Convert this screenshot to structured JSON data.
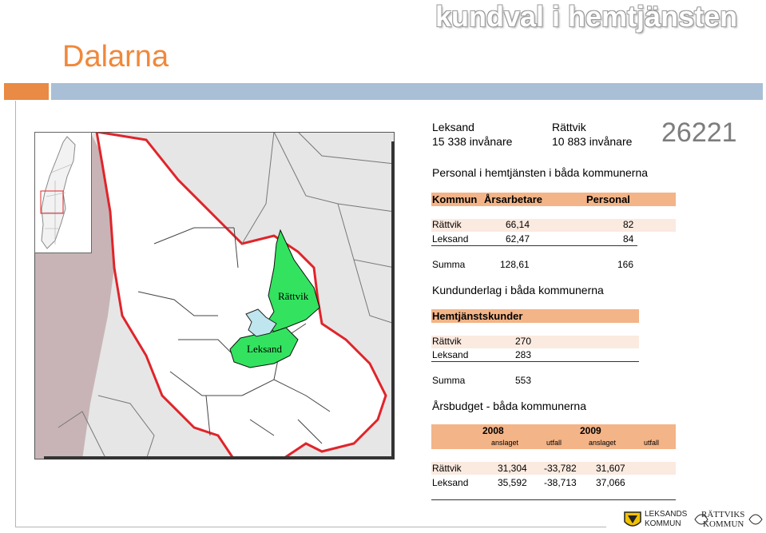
{
  "heading": "kundval i hemtjänsten",
  "title": "Dalarna",
  "municipalities": {
    "leksand_name": "Leksand",
    "leksand_pop": "15 338 invånare",
    "rattvik_name": "Rättvik",
    "rattvik_pop": "10 883 invånare",
    "code": "26221"
  },
  "map": {
    "label_rattvik": "Rättvik",
    "label_leksand": "Leksand",
    "colors": {
      "highlight": "#33e35f",
      "border": "#e0242a",
      "lake": "#bfe6ee",
      "outside": "#c8b4b6"
    }
  },
  "personal": {
    "title": "Personal i hemtjänsten i båda kommunerna",
    "headers": [
      "Kommun",
      "Årsarbetare",
      "Personal"
    ],
    "rows": [
      {
        "kommun": "Rättvik",
        "arsarbetare": "66,14",
        "personal": "82"
      },
      {
        "kommun": "Leksand",
        "arsarbetare": "62,47",
        "personal": "84"
      }
    ],
    "sum_label": "Summa",
    "sum_arsarbetare": "128,61",
    "sum_personal": "166"
  },
  "kundunderlag": {
    "title": "Kundunderlag i båda kommunerna",
    "header": "Hemtjänstskunder",
    "rows": [
      {
        "kommun": "Rättvik",
        "value": "270"
      },
      {
        "kommun": "Leksand",
        "value": "283"
      }
    ],
    "sum_label": "Summa",
    "sum_value": "553"
  },
  "budget": {
    "title": "Årsbudget - båda kommunerna",
    "year1": "2008",
    "year2": "2009",
    "subheaders": [
      "anslaget",
      "utfall",
      "anslaget",
      "utfall"
    ],
    "rows": [
      {
        "kommun": "Rättvik",
        "a2008": "31,304",
        "u2008": "-33,782",
        "a2009": "31,607"
      },
      {
        "kommun": "Leksand",
        "a2008": "35,592",
        "u2008": "-38,713",
        "a2009": "37,066"
      }
    ]
  },
  "logos": {
    "leksand_line1": "LEKSANDS",
    "leksand_line2": "KOMMUN",
    "rattvik_line1": "RÄTTVIKS",
    "rattvik_line2": "KOMMUN"
  }
}
